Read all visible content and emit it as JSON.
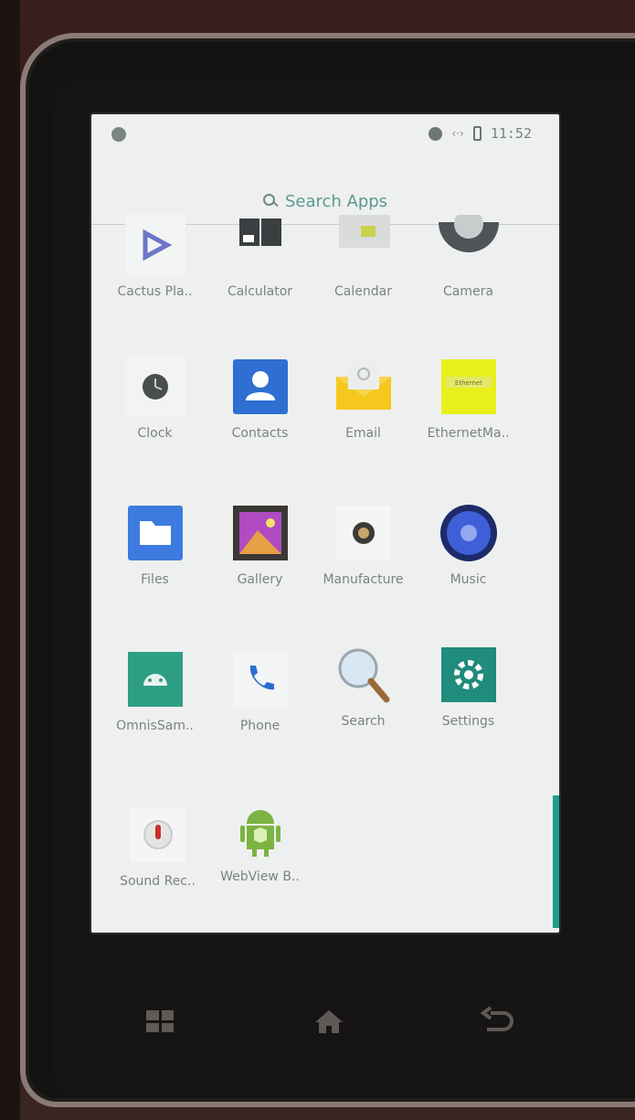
{
  "statusbar": {
    "time": "11:52",
    "icons": [
      "notification-dot-icon",
      "wifi-arrows-icon",
      "battery-icon"
    ]
  },
  "search": {
    "label": "Search Apps",
    "icon": "search-icon"
  },
  "apps": [
    {
      "label": "Cactus Pla..",
      "icon": "cactus-player-icon"
    },
    {
      "label": "Calculator",
      "icon": "calculator-icon"
    },
    {
      "label": "Calendar",
      "icon": "calendar-icon"
    },
    {
      "label": "Camera",
      "icon": "camera-icon"
    },
    {
      "label": "Clock",
      "icon": "clock-icon"
    },
    {
      "label": "Contacts",
      "icon": "contacts-icon"
    },
    {
      "label": "Email",
      "icon": "email-icon"
    },
    {
      "label": "EthernetMa..",
      "icon": "ethernet-manager-icon",
      "badge": "Ethernet"
    },
    {
      "label": "Files",
      "icon": "files-icon"
    },
    {
      "label": "Gallery",
      "icon": "gallery-icon"
    },
    {
      "label": "Manufacture",
      "icon": "manufacture-icon"
    },
    {
      "label": "Music",
      "icon": "music-icon"
    },
    {
      "label": "OmnisSam..",
      "icon": "android-omnis-icon"
    },
    {
      "label": "Phone",
      "icon": "phone-icon"
    },
    {
      "label": "Search",
      "icon": "search-app-icon"
    },
    {
      "label": "Settings",
      "icon": "settings-icon"
    },
    {
      "label": "Sound Rec..",
      "icon": "sound-recorder-icon"
    },
    {
      "label": "WebView B..",
      "icon": "webview-browser-icon"
    }
  ],
  "nav": {
    "icons": [
      "recent-apps-icon",
      "home-icon",
      "back-icon"
    ]
  },
  "colors": {
    "accent": "#1f9e89",
    "search_text": "#5b9a8e",
    "contacts_blue": "#2f6fd1",
    "email_yellow": "#f4c81c",
    "ethernet_yellow": "#e8ef1a",
    "settings_teal": "#1f8c7c",
    "android_green": "#7cb342"
  }
}
